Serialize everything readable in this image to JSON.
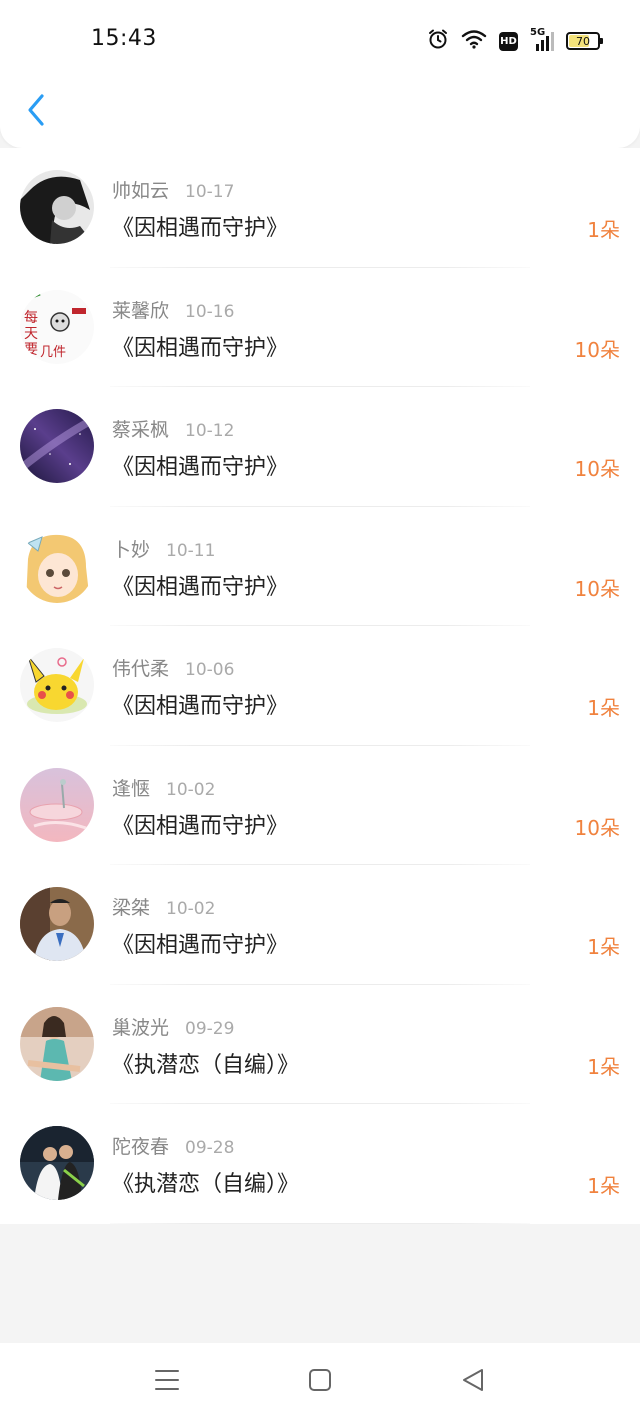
{
  "status_bar": {
    "time": "15:43",
    "network": "5G",
    "hd_label": "HD",
    "battery": "70",
    "battery_level": 0.7
  },
  "header": {
    "back_icon": "chevron-left-icon",
    "accent_color": "#2a9df4"
  },
  "gifts": [
    {
      "name": "帅如云",
      "date": "10-17",
      "title": "《因相遇而守护》",
      "count": "1朵",
      "avatar": "avatar-bw-person"
    },
    {
      "name": "莱馨欣",
      "date": "10-16",
      "title": "《因相遇而守护》",
      "count": "10朵",
      "avatar": "avatar-meme-text"
    },
    {
      "name": "蔡采枫",
      "date": "10-12",
      "title": "《因相遇而守护》",
      "count": "10朵",
      "avatar": "avatar-galaxy"
    },
    {
      "name": "卜妙",
      "date": "10-11",
      "title": "《因相遇而守护》",
      "count": "10朵",
      "avatar": "avatar-anime-girl"
    },
    {
      "name": "伟代柔",
      "date": "10-06",
      "title": "《因相遇而守护》",
      "count": "1朵",
      "avatar": "avatar-pikachu"
    },
    {
      "name": "逢惬",
      "date": "10-02",
      "title": "《因相遇而守护》",
      "count": "10朵",
      "avatar": "avatar-pink-scene"
    },
    {
      "name": "梁桀",
      "date": "10-02",
      "title": "《因相遇而守护》",
      "count": "1朵",
      "avatar": "avatar-man-photo"
    },
    {
      "name": "巢波光",
      "date": "09-29",
      "title": "《执潜恋（自编）》",
      "count": "1朵",
      "avatar": "avatar-woman-photo"
    },
    {
      "name": "陀夜春",
      "date": "09-28",
      "title": "《执潜恋（自编）》",
      "count": "1朵",
      "avatar": "avatar-couple-photo"
    }
  ],
  "colors": {
    "count": "#f0823e",
    "name": "#888888",
    "date": "#aaaaaa",
    "title": "#222222"
  },
  "nav_bar": {
    "menu_icon": "menu-icon",
    "home_icon": "home-square-icon",
    "back_icon": "back-triangle-icon"
  }
}
